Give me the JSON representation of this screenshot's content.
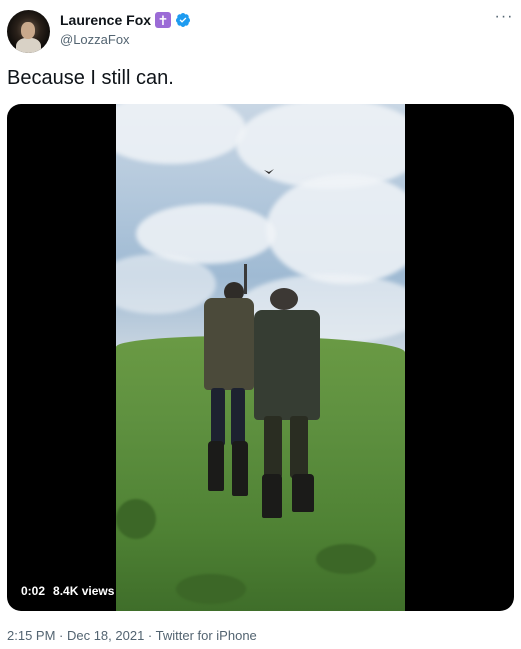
{
  "author": {
    "display_name": "Laurence Fox",
    "handle": "@LozzaFox",
    "badge_glyph": "✝",
    "badge_color": "#9b6bd6",
    "verified_color": "#1d9bf0"
  },
  "more_label": "···",
  "tweet_text": "Because I still can.",
  "media": {
    "duration": "0:02",
    "views": "8.4K views"
  },
  "footer": {
    "timestamp": "2:15 PM · Dec 18, 2021 · Twitter for iPhone"
  }
}
